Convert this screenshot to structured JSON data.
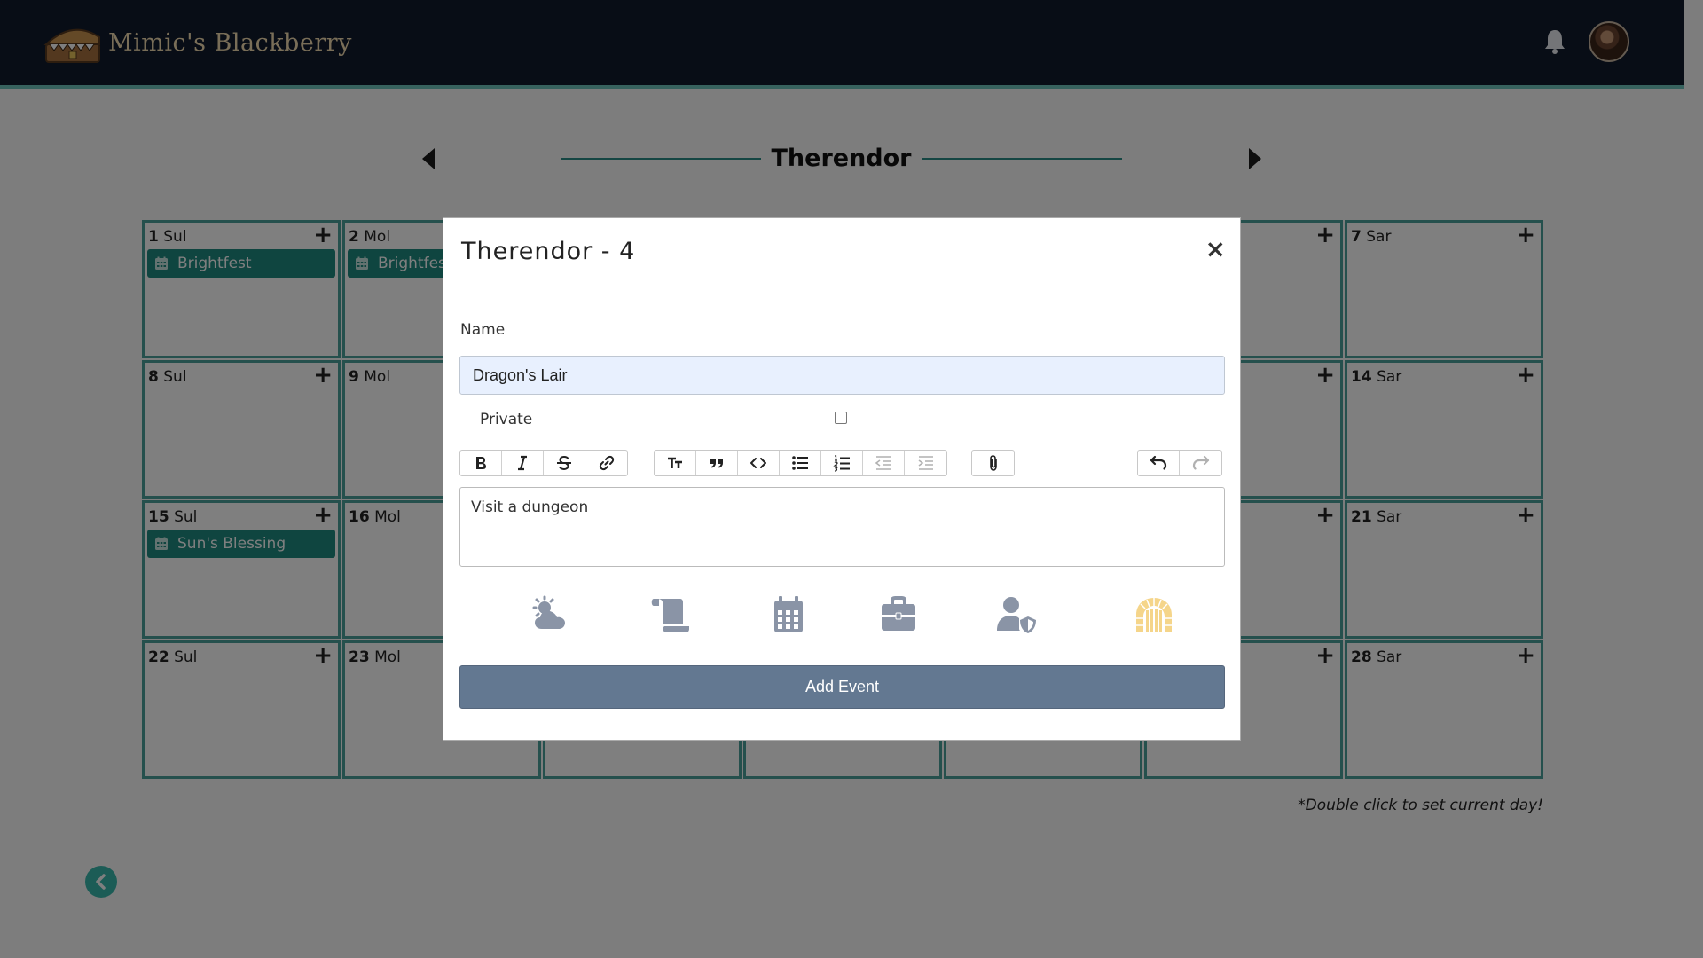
{
  "app": {
    "brand_name": "Mimic's Blackberry",
    "colors": {
      "navbar": "#111a2c",
      "accent": "#2a8c86",
      "event_chip": "#1f8a80",
      "button": "#637891"
    }
  },
  "header": {
    "bell_icon": "bell-icon",
    "avatar": "user-avatar"
  },
  "calendar": {
    "month_title": "Therendor",
    "hint": "*Double click to set current day!",
    "add_symbol": "+",
    "days": [
      {
        "num": "1",
        "wd": "Sul",
        "event": "Brightfest"
      },
      {
        "num": "2",
        "wd": "Mol",
        "event": "Brightfest"
      },
      {
        "num": "",
        "wd": "",
        "event": ""
      },
      {
        "num": "",
        "wd": "",
        "event": ""
      },
      {
        "num": "",
        "wd": "",
        "event": ""
      },
      {
        "num": "",
        "wd": "",
        "event": ""
      },
      {
        "num": "7",
        "wd": "Sar",
        "event": ""
      },
      {
        "num": "8",
        "wd": "Sul",
        "event": ""
      },
      {
        "num": "9",
        "wd": "Mol",
        "event": ""
      },
      {
        "num": "",
        "wd": "",
        "event": ""
      },
      {
        "num": "",
        "wd": "",
        "event": ""
      },
      {
        "num": "",
        "wd": "",
        "event": ""
      },
      {
        "num": "",
        "wd": "",
        "event": ""
      },
      {
        "num": "14",
        "wd": "Sar",
        "event": ""
      },
      {
        "num": "15",
        "wd": "Sul",
        "event": "Sun's Blessing"
      },
      {
        "num": "16",
        "wd": "Mol",
        "event": ""
      },
      {
        "num": "",
        "wd": "",
        "event": ""
      },
      {
        "num": "",
        "wd": "",
        "event": ""
      },
      {
        "num": "",
        "wd": "",
        "event": ""
      },
      {
        "num": "",
        "wd": "",
        "event": ""
      },
      {
        "num": "21",
        "wd": "Sar",
        "event": ""
      },
      {
        "num": "22",
        "wd": "Sul",
        "event": ""
      },
      {
        "num": "23",
        "wd": "Mol",
        "event": ""
      },
      {
        "num": "",
        "wd": "",
        "event": ""
      },
      {
        "num": "",
        "wd": "",
        "event": ""
      },
      {
        "num": "",
        "wd": "",
        "event": ""
      },
      {
        "num": "",
        "wd": "",
        "event": ""
      },
      {
        "num": "28",
        "wd": "Sar",
        "event": ""
      }
    ]
  },
  "modal": {
    "title": "Therendor - 4",
    "close": "×",
    "name_label": "Name",
    "name_value": "Dragon's Lair",
    "private_label": "Private",
    "private_checked": false,
    "editor_text": "Visit a dungeon",
    "submit_label": "Add Event",
    "toolbar": [
      [
        "bold-icon",
        "italic-icon",
        "strikethrough-icon",
        "link-icon"
      ],
      [
        "heading-icon",
        "quote-icon",
        "code-icon",
        "bullet-list-icon",
        "numbered-list-icon",
        "outdent-icon",
        "indent-icon"
      ],
      [
        "attach-icon"
      ],
      [
        "undo-icon",
        "redo-icon"
      ]
    ],
    "categories": [
      "weather-icon",
      "scroll-icon",
      "calendar-icon",
      "briefcase-icon",
      "user-shield-icon",
      "dungeon-icon"
    ],
    "selected_category": "dungeon-icon"
  }
}
